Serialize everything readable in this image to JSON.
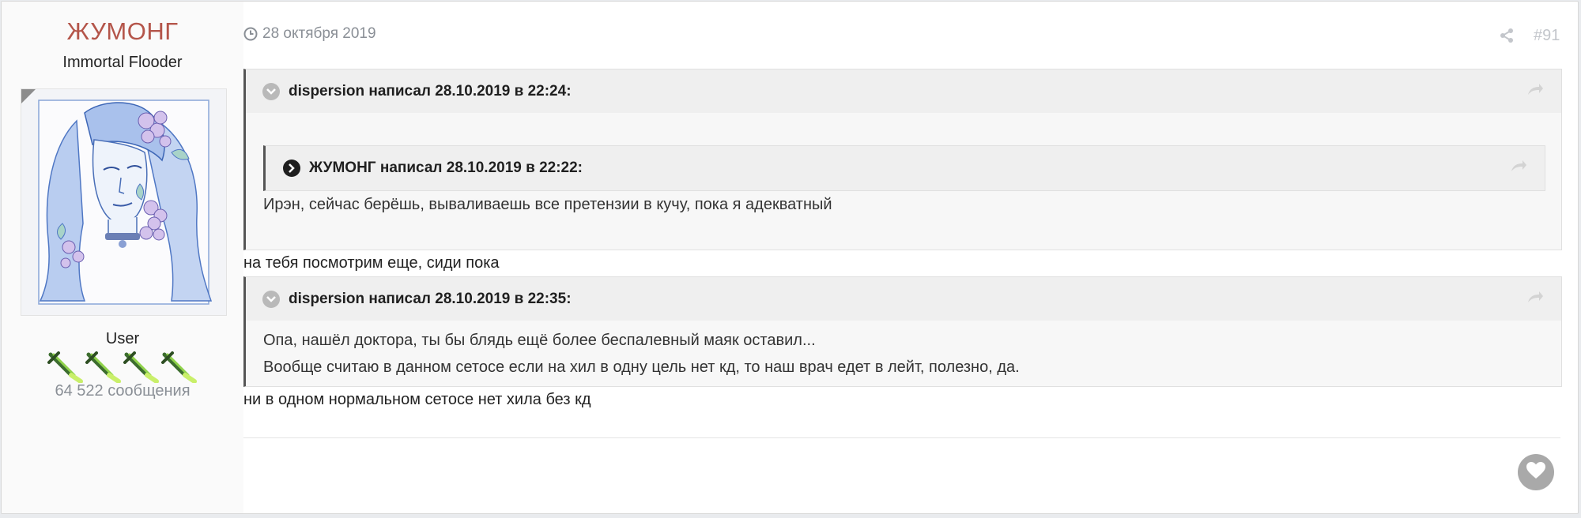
{
  "author": {
    "name": "ЖУМОНГ",
    "title": "Immortal Flooder",
    "group": "User",
    "post_count": "64 522 сообщения",
    "colors": {
      "name": "#b4554a",
      "count": "#8a8f96"
    }
  },
  "post": {
    "date": "28 октября 2019",
    "number": "#91",
    "icons": {
      "date": "clock-icon",
      "share": "share-icon",
      "like": "heart-icon"
    }
  },
  "quotes": [
    {
      "citation": "dispersion написал 28.10.2019 в 22:24:",
      "nested": {
        "citation": "ЖУМОНГ написал 28.10.2019 в 22:22:"
      },
      "lines": [
        "Ирэн, сейчас берёшь, вываливаешь все претензии в кучу, пока я адекватный"
      ]
    },
    {
      "citation": "dispersion написал 28.10.2019 в 22:35:",
      "lines": [
        "Опа, нашёл доктора, ты бы блядь ещё более беспалевный маяк оставил...",
        "Вообще считаю в данном сетосе если на хил в одну цель нет кд, то наш врач едет в лейт, полезно, да."
      ]
    }
  ],
  "replies": [
    "на тебя посмотрим еще, сиди пока",
    "ни в одном нормальном сетосе нет хила без кд"
  ]
}
